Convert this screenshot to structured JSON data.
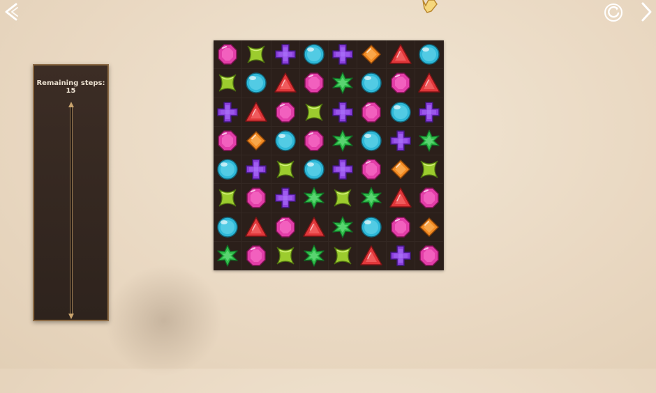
{
  "hud": {
    "steps_label": "Remaining steps: 15",
    "steps_remaining": 15,
    "progress_fraction": 0
  },
  "icons": {
    "back": "back-arrow-icon",
    "reload": "reload-icon",
    "next": "next-chevron-icon",
    "cursor": "hand-cursor-icon"
  },
  "gem_colors": {
    "pink-octagon": "#e23ea8",
    "green-x": "#9ccc2e",
    "purple-cross": "#8a3fdc",
    "cyan-circle": "#2fb8d8",
    "orange-diamond": "#f28a22",
    "red-triangle": "#e0373a",
    "green-star": "#2fbd4a"
  },
  "board": [
    [
      "pink-octagon",
      "green-x",
      "purple-cross",
      "cyan-circle",
      "purple-cross",
      "orange-diamond",
      "red-triangle",
      "cyan-circle"
    ],
    [
      "green-x",
      "cyan-circle",
      "red-triangle",
      "pink-octagon",
      "green-star",
      "cyan-circle",
      "pink-octagon",
      "red-triangle"
    ],
    [
      "purple-cross",
      "red-triangle",
      "pink-octagon",
      "green-x",
      "purple-cross",
      "pink-octagon",
      "cyan-circle",
      "purple-cross"
    ],
    [
      "pink-octagon",
      "orange-diamond",
      "cyan-circle",
      "pink-octagon",
      "green-star",
      "cyan-circle",
      "purple-cross",
      "green-star"
    ],
    [
      "cyan-circle",
      "purple-cross",
      "green-x",
      "cyan-circle",
      "purple-cross",
      "pink-octagon",
      "orange-diamond",
      "green-x"
    ],
    [
      "green-x",
      "pink-octagon",
      "purple-cross",
      "green-star",
      "green-x",
      "green-star",
      "red-triangle",
      "pink-octagon"
    ],
    [
      "cyan-circle",
      "red-triangle",
      "pink-octagon",
      "red-triangle",
      "green-star",
      "cyan-circle",
      "pink-octagon",
      "orange-diamond"
    ],
    [
      "green-star",
      "pink-octagon",
      "green-x",
      "green-star",
      "green-x",
      "red-triangle",
      "purple-cross",
      "pink-octagon"
    ]
  ]
}
